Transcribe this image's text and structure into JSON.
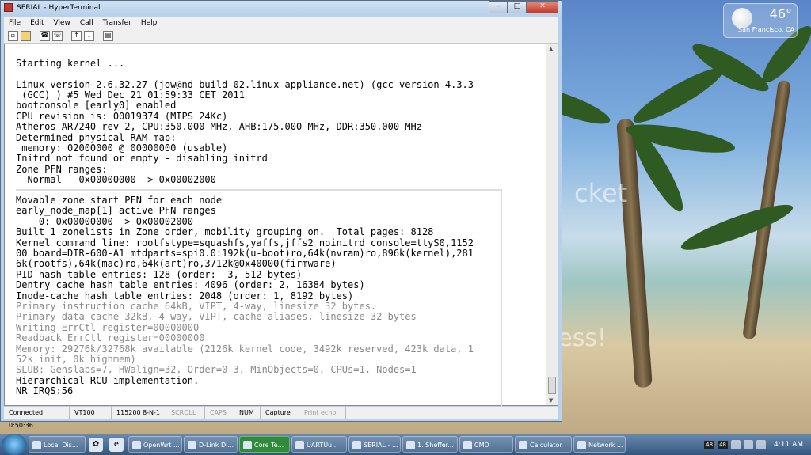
{
  "window": {
    "title": "SERIAL - HyperTerminal",
    "caption_buttons": {
      "minimize": "–",
      "maximize": "□",
      "close": "✕"
    }
  },
  "menu": [
    "File",
    "Edit",
    "View",
    "Call",
    "Transfer",
    "Help"
  ],
  "toolbar_icons": [
    "new-icon",
    "open-icon",
    "connect-icon",
    "disconnect-icon",
    "send-icon",
    "receive-icon",
    "properties-icon"
  ],
  "terminal_lines": [
    "Starting kernel ...",
    "",
    "Linux version 2.6.32.27 (jow@nd-build-02.linux-appliance.net) (gcc version 4.3.3",
    " (GCC) ) #5 Wed Dec 21 01:59:33 CET 2011",
    "bootconsole [early0] enabled",
    "CPU revision is: 00019374 (MIPS 24Kc)",
    "Atheros AR7240 rev 2, CPU:350.000 MHz, AHB:175.000 MHz, DDR:350.000 MHz",
    "Determined physical RAM map:",
    " memory: 02000000 @ 00000000 (usable)",
    "Initrd not found or empty - disabling initrd",
    "Zone PFN ranges:",
    "  Normal   0x00000000 -> 0x00002000",
    "Movable zone start PFN for each node",
    "early_node_map[1] active PFN ranges",
    "    0: 0x00000000 -> 0x00002000",
    "Built 1 zonelists in Zone order, mobility grouping on.  Total pages: 8128",
    "Kernel command line: rootfstype=squashfs,yaffs,jffs2 noinitrd console=ttyS0,1152",
    "00 board=DIR-600-A1 mtdparts=spi0.0:192k(u-boot)ro,64k(nvram)ro,896k(kernel),281",
    "6k(rootfs),64k(mac)ro,64k(art)ro,3712k@0x40000(firmware)",
    "PID hash table entries: 128 (order: -3, 512 bytes)",
    "Dentry cache hash table entries: 4096 (order: 2, 16384 bytes)",
    "Inode-cache hash table entries: 2048 (order: 1, 8192 bytes)",
    "Primary instruction cache 64kB, VIPT, 4-way, linesize 32 bytes.",
    "Primary data cache 32kB, 4-way, VIPT, cache aliases, linesize 32 bytes",
    "Writing ErrCtl register=00000000",
    "Readback ErrCtl register=00000000",
    "Memory: 29276k/32768k available (2126k kernel code, 3492k reserved, 423k data, 1",
    "52k init, 0k highmem)",
    "SLUB: Genslabs=7, HWalign=32, Order=0-3, MinObjects=0, CPUs=1, Nodes=1",
    "Hierarchical RCU implementation.",
    "NR_IRQS:56"
  ],
  "status": {
    "connected": "Connected 0:50:36",
    "emulation": "VT100",
    "port_settings": "115200 8-N-1",
    "scroll": "SCROLL",
    "caps": "CAPS",
    "num": "NUM",
    "capture": "Capture",
    "print_echo": "Print echo"
  },
  "weather": {
    "temperature": "46°",
    "city": "San Francisco, CA"
  },
  "taskbar": {
    "items": [
      "Local Dis...",
      "OpenWrt ...",
      "D-Link DI...",
      "Core Te...",
      "UARTUu...",
      "SERIAL - ...",
      "1. Sheffer...",
      "CMD",
      "Calculator",
      "Network ..."
    ],
    "tray_numbers": [
      "48",
      "48"
    ],
    "clock": "4:11 AM"
  }
}
